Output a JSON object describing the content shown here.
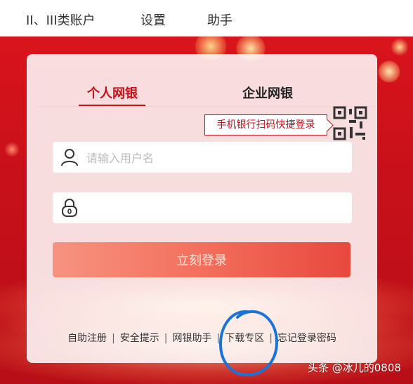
{
  "nav": {
    "items": [
      {
        "label": "II、III类账户"
      },
      {
        "label": "设置"
      },
      {
        "label": "助手"
      }
    ]
  },
  "login": {
    "tabs": {
      "personal": "个人网银",
      "corporate": "企业网银"
    },
    "qr_tip": "手机银行扫码快捷登录",
    "username_placeholder": "请输入用户名",
    "password_value": "",
    "submit_label": "立刻登录"
  },
  "links": {
    "items": [
      {
        "label": "自助注册"
      },
      {
        "label": "安全提示"
      },
      {
        "label": "网银助手"
      },
      {
        "label": "下载专区"
      },
      {
        "label": "忘记登录密码"
      }
    ]
  },
  "watermark": "头条 @冰儿的0808",
  "colors": {
    "brand_red": "#c8101a",
    "annotation_blue": "#1a73d6"
  }
}
